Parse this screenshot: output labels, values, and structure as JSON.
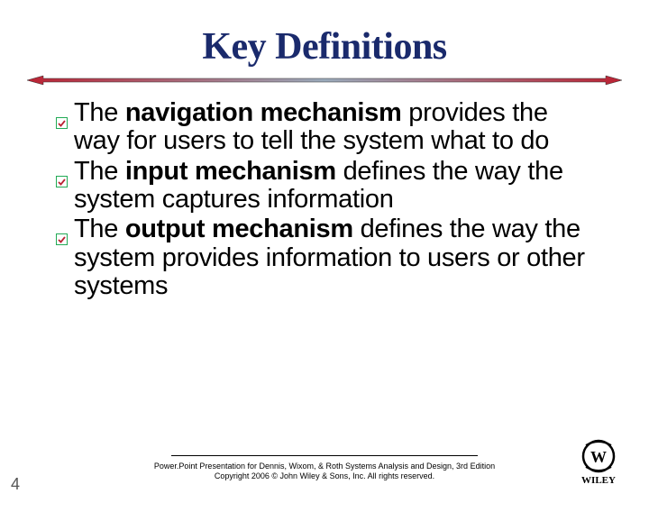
{
  "title": "Key Definitions",
  "bullets": [
    {
      "pre": "The ",
      "bold": "navigation mechanism",
      "post": " provides the way for users to tell the system what to do"
    },
    {
      "pre": "The ",
      "bold": "input mechanism",
      "post": " defines the way the system captures  information"
    },
    {
      "pre": "The ",
      "bold": "output mechanism",
      "post": " defines the way the system provides information to users or other systems"
    }
  ],
  "footer": {
    "line1": "Power.Point Presentation for Dennis, Wixom, & Roth Systems Analysis and Design, 3rd Edition",
    "line2": "Copyright 2006 © John Wiley & Sons, Inc.  All rights reserved."
  },
  "page_number": "4",
  "logo_label": "WILEY"
}
